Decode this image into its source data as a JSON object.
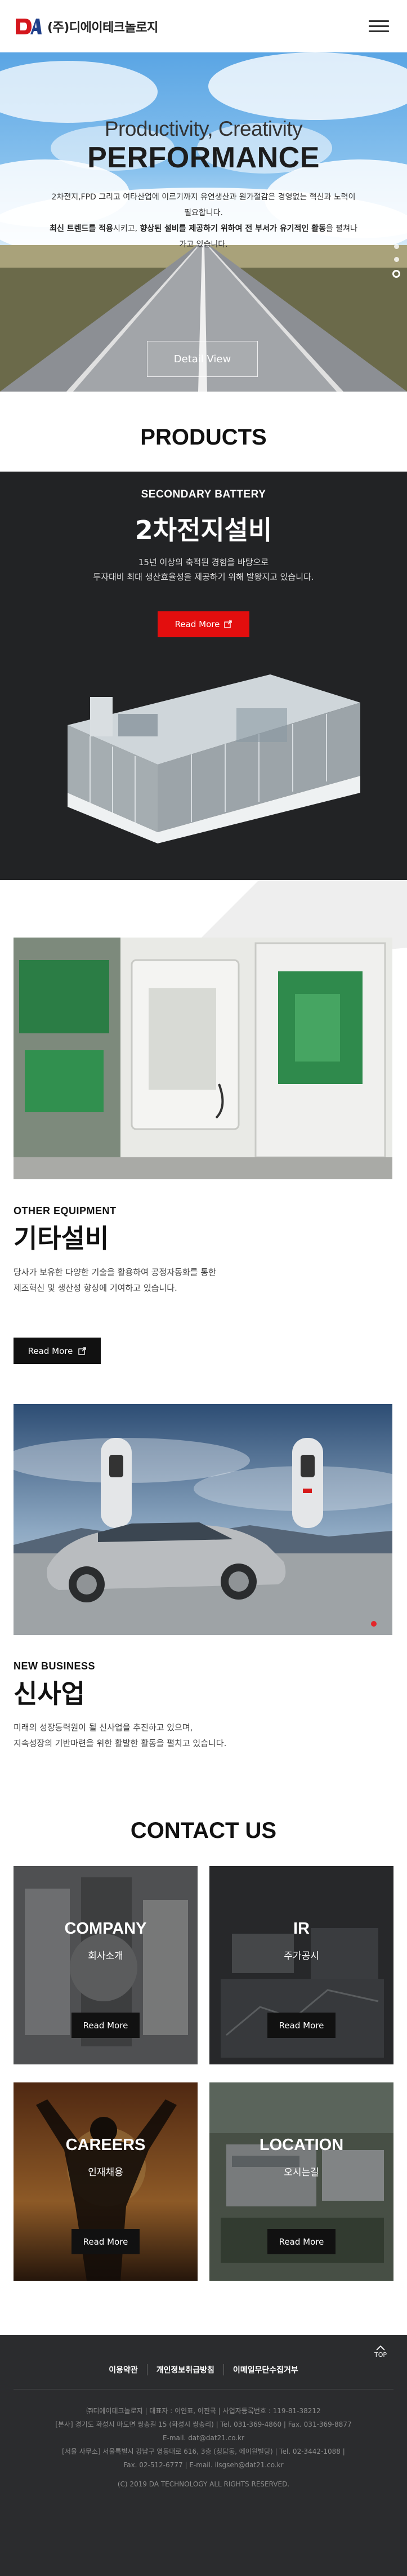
{
  "header": {
    "logo_text": "(주)디에이테크놀로지",
    "logo_mark": "DA"
  },
  "hero": {
    "subtitle": "Productivity, Creativity",
    "title": "PERFORMANCE",
    "desc_line1": "2차전지,FPD 그리고 여타산업에 이르기까지 유연생산과 원가절감은 경영없는 혁신과 노력이",
    "desc_line2": "필요합니다.",
    "desc_line3a": "최신 트렌드를 적용",
    "desc_line3b": "시키고, ",
    "desc_line3c": "향상된 설비를 제공하기 위하여 전 부서가 유기적인 활동",
    "desc_line3d": "을 펼쳐나",
    "desc_line4": "가고 있습니다.",
    "button": "Detail View"
  },
  "products": {
    "title": "PRODUCTS",
    "battery": {
      "eyebrow": "SECONDARY BATTERY",
      "title": "2차전지설비",
      "desc_line1": "15년 이상의 축적된 경험을 바탕으로",
      "desc_line2": "투자대비 최대 생산효율성을 제공하기 위해 발왕지고 있습니다.",
      "button": "Read More"
    },
    "other": {
      "eyebrow": "OTHER EQUIPMENT",
      "title": "기타설비",
      "desc_line1": "당사가 보유한 다양한 기술을 활용하여 공정자동화를 통한",
      "desc_line2": "제조혁신 및 생산성 향상에 기여하고 있습니다.",
      "button": "Read More"
    },
    "newbiz": {
      "eyebrow": "NEW BUSINESS",
      "title": "신사업",
      "desc_line1": "미래의 성장동력원이 될 신사업을 추진하고 있으며,",
      "desc_line2": "지속성장의 기반마련을 위한 활발한 활동을 펼치고 있습니다."
    }
  },
  "contact": {
    "title": "CONTACT US",
    "cards": [
      {
        "title": "COMPANY",
        "sub": "회사소개",
        "button": "Read More"
      },
      {
        "title": "IR",
        "sub": "주가공시",
        "button": "Read More"
      },
      {
        "title": "CAREERS",
        "sub": "인재채용",
        "button": "Read More"
      },
      {
        "title": "LOCATION",
        "sub": "오시는길",
        "button": "Read More"
      }
    ]
  },
  "footer": {
    "links": [
      "이용약관",
      "개인정보취급방침",
      "이메일무단수집거부"
    ],
    "info_line1": "㈜디에이테크놀로지 | 대표자 : 이연표, 이진국 | 사업자등록번호 : 119-81-38212",
    "info_line2": "[본사] 경기도 화성시 마도면 쌍송길 15 (화성시 쌍송리) | Tel. 031-369-4860 | Fax. 031-369-8877",
    "info_line3": "E-mail. dat@dat21.co.kr",
    "info_line4": "[서울 사무소] 서울특별시 강남구 영동대로 616, 3층 (청담동, 에이원빌딩) | Tel. 02-3442-1088 |",
    "info_line5": "Fax. 02-512-6777 | E-mail. ilsgseh@dat21.co.kr",
    "copyright": "(C) 2019 DA TECHNOLOGY ALL RIGHTS RESERVED.",
    "top": "TOP"
  }
}
